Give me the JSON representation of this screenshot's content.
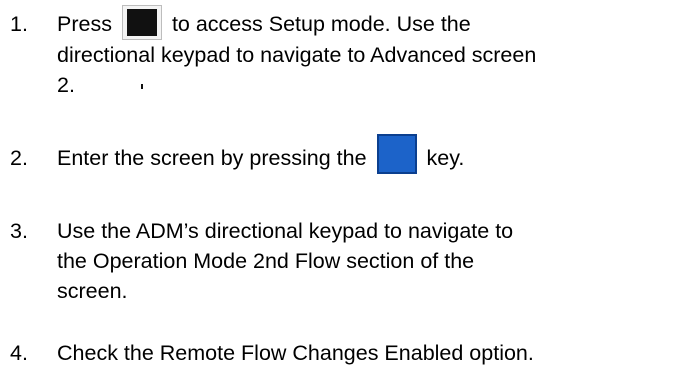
{
  "steps": [
    {
      "number": "1.",
      "line1_before": "Press",
      "icon1": "unlock-key-icon",
      "line1_after": "to access Setup mode. Use the",
      "line2": "directional keypad to navigate to Advanced screen",
      "line3": "2."
    },
    {
      "number": "2.",
      "before": "Enter the screen by pressing the",
      "icon": "edit-enter-key-icon",
      "after": "key."
    },
    {
      "number": "3.",
      "line1": "Use the ADM’s directional keypad to navigate to",
      "line2": "the Operation Mode 2nd Flow section of the",
      "line3": "screen."
    },
    {
      "number": "4.",
      "line1": "Check the Remote Flow Changes Enabled option."
    }
  ],
  "colors": {
    "text": "#000000",
    "lock_key_bg": "#111111",
    "edit_key_blue": "#1c63c9"
  }
}
